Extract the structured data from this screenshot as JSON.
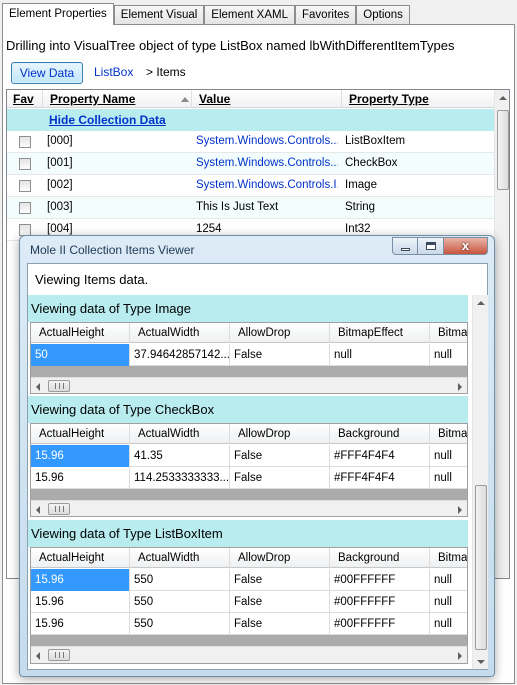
{
  "tabs": [
    "Element Properties",
    "Element Visual",
    "Element XAML",
    "Favorites",
    "Options"
  ],
  "drill_text": "Drilling into VisualTree object of type ListBox named lbWithDifferentItemTypes",
  "view_data_label": "View Data",
  "breadcrumb": {
    "link": "ListBox",
    "current": "> Items"
  },
  "grid": {
    "headers": {
      "fav": "Fav",
      "name": "Property Name",
      "value": "Value",
      "type": "Property Type"
    },
    "hide_link": "Hide Collection Data",
    "rows": [
      {
        "name": "[000]",
        "value": "System.Windows.Controls....",
        "type": "ListBoxItem",
        "link": true
      },
      {
        "name": "[001]",
        "value": "System.Windows.Controls....",
        "type": "CheckBox",
        "link": true
      },
      {
        "name": "[002]",
        "value": "System.Windows.Controls.I...",
        "type": "Image",
        "link": true
      },
      {
        "name": "[003]",
        "value": "This Is Just Text",
        "type": "String",
        "link": false
      },
      {
        "name": "[004]",
        "value": "1254",
        "type": "Int32",
        "link": false
      }
    ]
  },
  "window": {
    "title": "Mole II Collection Items Viewer",
    "close_glyph": "x",
    "viewing_label": "Viewing Items data.",
    "sections": [
      {
        "title": "Viewing data of Type Image",
        "columns": [
          "ActualHeight",
          "ActualWidth",
          "AllowDrop",
          "BitmapEffect",
          "Bitmap"
        ],
        "rows": [
          [
            "50",
            "37.94642857142...",
            "False",
            "null",
            "null"
          ]
        ]
      },
      {
        "title": "Viewing data of Type CheckBox",
        "columns": [
          "ActualHeight",
          "ActualWidth",
          "AllowDrop",
          "Background",
          "Bitmap"
        ],
        "rows": [
          [
            "15.96",
            "41.35",
            "False",
            "#FFF4F4F4",
            "null"
          ],
          [
            "15.96",
            "114.2533333333...",
            "False",
            "#FFF4F4F4",
            "null"
          ]
        ]
      },
      {
        "title": "Viewing data of Type ListBoxItem",
        "columns": [
          "ActualHeight",
          "ActualWidth",
          "AllowDrop",
          "Background",
          "Bitmap"
        ],
        "rows": [
          [
            "15.96",
            "550",
            "False",
            "#00FFFFFF",
            "null"
          ],
          [
            "15.96",
            "550",
            "False",
            "#00FFFFFF",
            "null"
          ],
          [
            "15.96",
            "550",
            "False",
            "#00FFFFFF",
            "null"
          ]
        ]
      }
    ]
  },
  "colors": {
    "accent": "#0033cc",
    "section_bg": "#b8ecef",
    "selection": "#3399ff"
  }
}
